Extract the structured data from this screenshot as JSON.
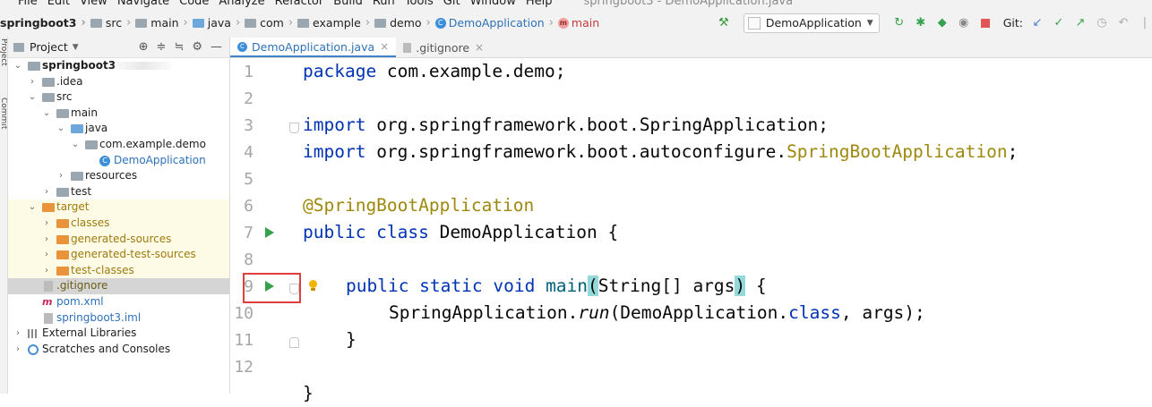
{
  "menu": {
    "items": [
      "File",
      "Edit",
      "View",
      "Navigate",
      "Code",
      "Analyze",
      "Refactor",
      "Build",
      "Run",
      "Tools",
      "Git",
      "Window",
      "Help"
    ],
    "window_title": "springboot3 - DemoApplication.java"
  },
  "breadcrumbs": [
    "springboot3",
    "src",
    "main",
    "java",
    "com",
    "example",
    "demo",
    "DemoApplication",
    "main"
  ],
  "toolbar": {
    "run_config": "DemoApplication",
    "git_label": "Git:"
  },
  "sidebar": {
    "strip_labels": [
      "Project",
      "Commit"
    ],
    "panel_title": "Project"
  },
  "tree": [
    {
      "label": "springboot3",
      "suffix": "",
      "kind": "module"
    },
    {
      "label": ".idea",
      "kind": "folder"
    },
    {
      "label": "src",
      "kind": "folder"
    },
    {
      "label": "main",
      "kind": "folder"
    },
    {
      "label": "java",
      "kind": "folder-blue"
    },
    {
      "label": "com.example.demo",
      "kind": "package"
    },
    {
      "label": "DemoApplication",
      "kind": "class"
    },
    {
      "label": "resources",
      "kind": "folder"
    },
    {
      "label": "test",
      "kind": "folder"
    },
    {
      "label": "target",
      "kind": "folder-orange"
    },
    {
      "label": "classes",
      "kind": "folder-orange"
    },
    {
      "label": "generated-sources",
      "kind": "folder-orange"
    },
    {
      "label": "generated-test-sources",
      "kind": "folder-orange"
    },
    {
      "label": "test-classes",
      "kind": "folder-orange"
    },
    {
      "label": ".gitignore",
      "kind": "file"
    },
    {
      "label": "pom.xml",
      "kind": "maven"
    },
    {
      "label": "springboot3.iml",
      "kind": "file"
    },
    {
      "label": "External Libraries",
      "kind": "libs"
    },
    {
      "label": "Scratches and Consoles",
      "kind": "scratch"
    }
  ],
  "tabs": [
    {
      "label": "DemoApplication.java",
      "active": true
    },
    {
      "label": ".gitignore",
      "active": false
    }
  ],
  "line_numbers": [
    "1",
    "2",
    "3",
    "4",
    "5",
    "6",
    "7",
    "8",
    "9",
    "10",
    "11",
    "12"
  ],
  "code": {
    "l1_kw": "package",
    "l1_rest": " com.example.demo;",
    "l3_kw": "import",
    "l3_rest": " org.springframework.boot.SpringApplication;",
    "l4_kw": "import",
    "l4_rest": " org.springframework.boot.autoconfigure.",
    "l4_ann": "SpringBootApplication",
    "l4_end": ";",
    "l6_ann": "@SpringBootApplication",
    "l7_kw": "public class",
    "l7_rest": " DemoApplication {",
    "l9_kw": "public static void",
    "l9_meth": " main",
    "l9_p1": "(",
    "l9_mid": "String[] args",
    "l9_p2": ")",
    "l9_end": " {",
    "l10_a": "SpringApplication.",
    "l10_run": "run",
    "l10_b": "(DemoApplication.",
    "l10_kw": "class",
    "l10_c": ", args);",
    "l11": "}",
    "l13": "}"
  }
}
